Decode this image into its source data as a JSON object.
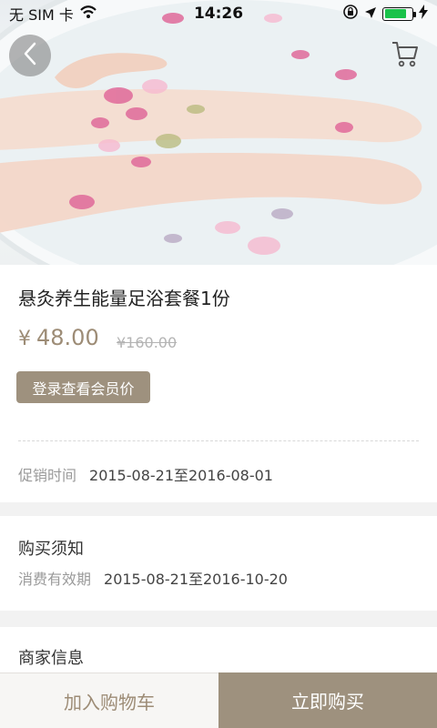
{
  "status_bar": {
    "carrier": "无 SIM 卡",
    "time": "14:26",
    "battery_level": 0.85,
    "icons": [
      "wifi-icon",
      "orientation-lock-icon",
      "location-arrow-icon",
      "battery-icon",
      "charging-icon"
    ]
  },
  "header": {
    "back_icon": "chevron-left-icon",
    "cart_icon": "shopping-cart-icon"
  },
  "product": {
    "title": "悬灸养生能量足浴套餐1份",
    "currency_symbol": "¥",
    "price": "48.00",
    "original_price": "¥160.00",
    "member_button_label": "登录查看会员价",
    "promo_label": "促销时间",
    "promo_value": "2015-08-21至2016-08-01"
  },
  "purchase_notice": {
    "title": "购买须知",
    "validity_label": "消费有效期",
    "validity_value": "2015-08-21至2016-10-20"
  },
  "merchant": {
    "title": "商家信息"
  },
  "bottom_bar": {
    "add_to_cart_label": "加入购物车",
    "buy_now_label": "立即购买"
  },
  "colors": {
    "accent": "#9e917e",
    "price": "#9d8c76",
    "battery": "#19c24a"
  }
}
